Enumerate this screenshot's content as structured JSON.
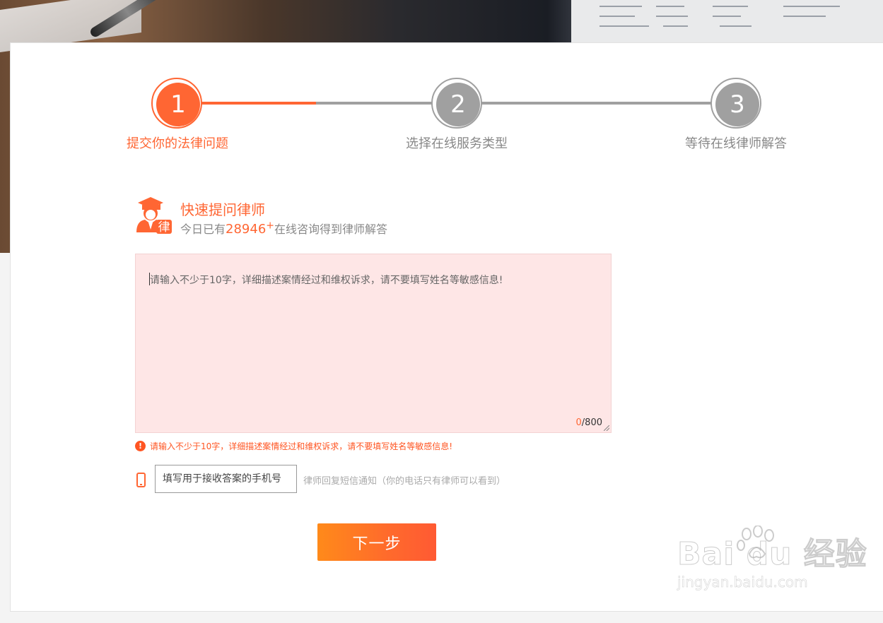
{
  "steps": [
    {
      "number": "1",
      "label": "提交你的法律问题",
      "state": "active"
    },
    {
      "number": "2",
      "label": "选择在线服务类型",
      "state": "inactive"
    },
    {
      "number": "3",
      "label": "等待在线律师解答",
      "state": "inactive"
    }
  ],
  "ask": {
    "icon_char": "律",
    "title": "快速提问律师",
    "sub_prefix": "今日已有",
    "count": "28946",
    "plus": "+",
    "sub_suffix": "在线咨询得到律师解答"
  },
  "question": {
    "placeholder": "请输入不少于10字，详细描述案情经过和维权诉求，请不要填写姓名等敏感信息!",
    "current_count": "0",
    "max_count": "/800"
  },
  "error": {
    "icon": "!",
    "message": "请输入不少于10字，详细描述案情经过和维权诉求，请不要填写姓名等敏感信息!"
  },
  "phone": {
    "placeholder": "填写用于接收答案的手机号",
    "note": "律师回复短信通知（你的电话只有律师可以看到）"
  },
  "next_button": "下一步",
  "watermark": {
    "brand": "Bai du 经验",
    "url": "jingyan.baidu.com"
  },
  "colors": {
    "accent": "#ff6633",
    "inactive": "#a0a0a0",
    "textarea_bg": "#fee6e6"
  },
  "icons": [
    "lawyer-avatar-icon",
    "error-icon",
    "phone-icon",
    "baidu-paw-icon"
  ]
}
